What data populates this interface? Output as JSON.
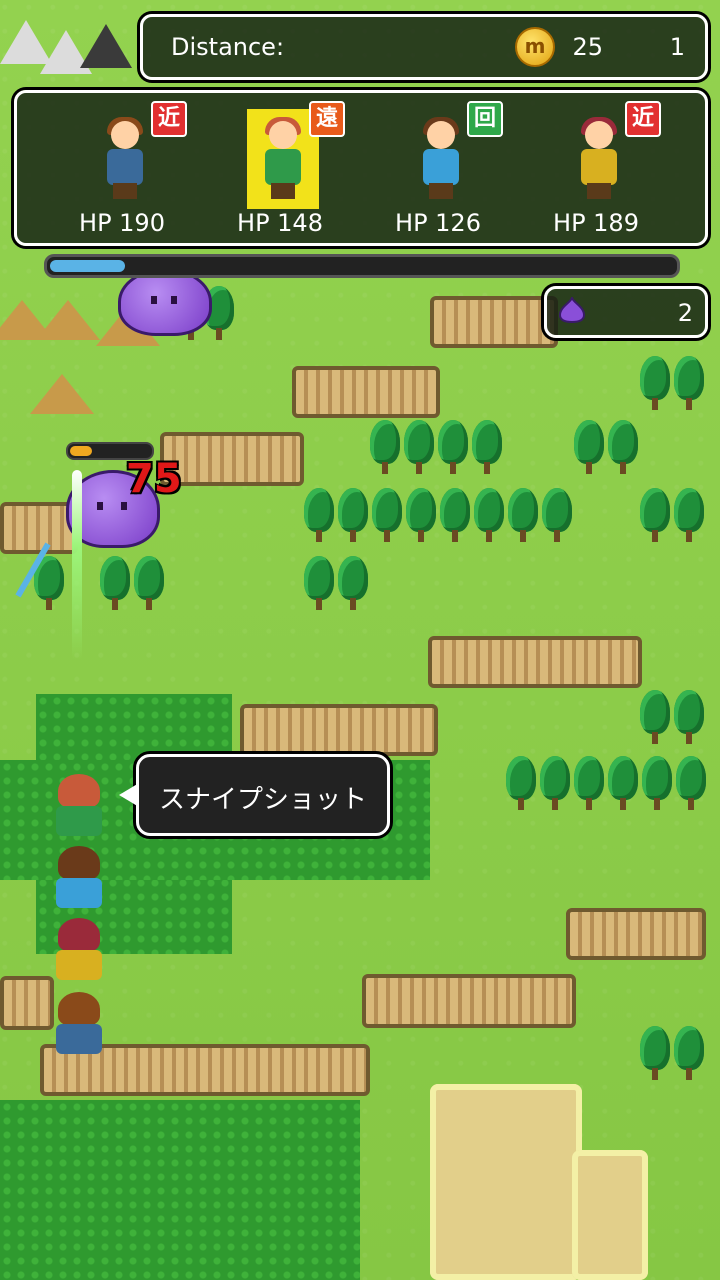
{
  "hud": {
    "distance_label": "Distance:",
    "distance_value": "25",
    "coin_symbol": "m",
    "coin_count": "1"
  },
  "party": [
    {
      "role": "近",
      "role_color": "#e23030",
      "hp": "HP 190",
      "hair": "#8a4a1a",
      "body": "#3a6a9a",
      "active": false
    },
    {
      "role": "遠",
      "role_color": "#e85a1a",
      "hp": "HP 148",
      "hair": "#c85a3a",
      "body": "#2f9a4a",
      "active": true
    },
    {
      "role": "回",
      "role_color": "#2fa84a",
      "hp": "HP 126",
      "hair": "#6a3a1a",
      "body": "#3aa0d8",
      "active": false
    },
    {
      "role": "近",
      "role_color": "#e23030",
      "hp": "HP 189",
      "hair": "#9a2a3a",
      "body": "#d8b020",
      "active": false
    }
  ],
  "progress": {
    "fraction": 0.12
  },
  "enemy_counter": {
    "icon": "slime-icon",
    "count": "2"
  },
  "battle": {
    "damage": "75",
    "enemy_hp_fraction": 0.28,
    "skill_name": "スナイプショット"
  },
  "colors": {
    "hud_bg": "#141e14",
    "progress_fill": "#5ab3e6",
    "slime": "#8a4fd8",
    "damage": "#e01818"
  }
}
